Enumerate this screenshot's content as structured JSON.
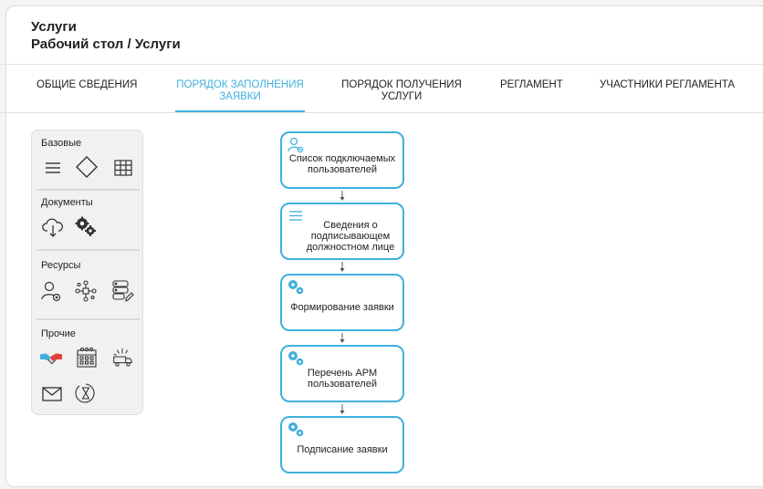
{
  "header": {
    "title": "Услуги",
    "breadcrumb": "Рабочий стол / Услуги"
  },
  "tabs": [
    {
      "label": "ОБЩИЕ СВЕДЕНИЯ",
      "active": false
    },
    {
      "label": "ПОРЯДОК ЗАПОЛНЕНИЯ ЗАЯВКИ",
      "active": true
    },
    {
      "label": "ПОРЯДОК ПОЛУЧЕНИЯ УСЛУГИ",
      "active": false
    },
    {
      "label": "РЕГЛАМЕНТ",
      "active": false
    },
    {
      "label": "УЧАСТНИКИ РЕГЛАМЕНТА",
      "active": false
    }
  ],
  "palette": {
    "sections": [
      {
        "title": "Базовые",
        "icons": [
          "list-icon",
          "diamond-icon",
          "table-icon"
        ]
      },
      {
        "title": "Документы",
        "icons": [
          "cloud-download-icon",
          "gears-icon"
        ]
      },
      {
        "title": "Ресурсы",
        "icons": [
          "user-add-icon",
          "network-icon",
          "database-edit-icon"
        ]
      },
      {
        "title": "Прочие",
        "icons": [
          "handshake-icon",
          "calendar-icon",
          "truck-icon",
          "mail-icon",
          "timer-icon"
        ]
      }
    ]
  },
  "flow": {
    "nodes": [
      {
        "label": "Список подключаемых пользователей",
        "icon": "user-gear-icon"
      },
      {
        "label": "Сведения о подписывающем должностном лице",
        "icon": "list-icon"
      },
      {
        "label": "Формирование заявки",
        "icon": "gears-icon"
      },
      {
        "label": "Перечень АРМ пользователей",
        "icon": "gears-icon"
      },
      {
        "label": "Подписание заявки",
        "icon": "gears-icon"
      }
    ]
  },
  "colors": {
    "accent": "#3fb0dd",
    "handshake_red": "#e0403a",
    "handshake_blue": "#3fb0dd"
  }
}
